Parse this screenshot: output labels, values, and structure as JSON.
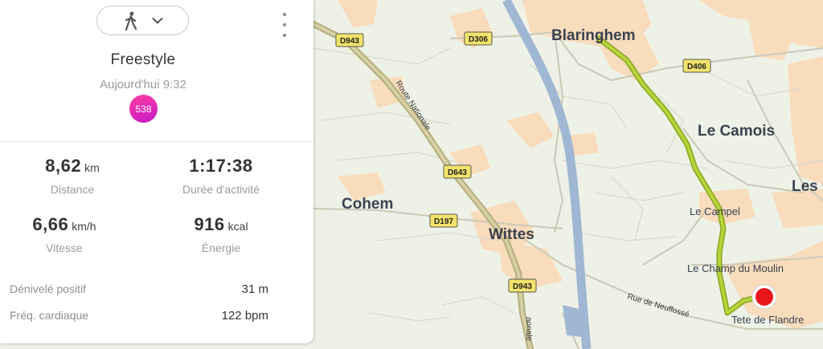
{
  "activity": {
    "type_icon": "walking-person-icon",
    "title": "Freestyle",
    "date": "Aujourd'hui 9:32",
    "badge": "538"
  },
  "stats": [
    {
      "value": "8,62",
      "unit": "km",
      "label": "Distance"
    },
    {
      "value": "1:17:38",
      "unit": "",
      "label": "Durée d'activité"
    },
    {
      "value": "6,66",
      "unit": "km/h",
      "label": "Vitesse"
    },
    {
      "value": "916",
      "unit": "kcal",
      "label": "Énergie"
    }
  ],
  "details": [
    {
      "label": "Dénivelé positif",
      "value": "31 m"
    },
    {
      "label": "Fréq. cardiaque",
      "value": "122 bpm"
    }
  ],
  "map": {
    "places": {
      "blaringhem": "Blaringhem",
      "le_camois": "Le Camois",
      "les_c": "Les C",
      "cohem": "Cohem",
      "wittes": "Wittes",
      "le_campel": "Le Campel",
      "le_champ_du_moulin": "Le Champ du Moulin",
      "tete_de_flandre": "Tete de Flandre"
    },
    "roads": {
      "d943_a": "D943",
      "d943_b": "D943",
      "d306": "D306",
      "d406": "D406",
      "d643": "D643",
      "d197": "D197",
      "route_nationale": "Route Nationale",
      "rue_de_neuffosse": "Rue de Neuffossé",
      "route_nationale_bottom": "aonale"
    },
    "colors": {
      "land": "#eef2e6",
      "urban": "#f6d9b8",
      "road": "#cfcbb8",
      "main_road": "#b5ae7d",
      "canal": "#9fb7d2",
      "track": "#b4cc3a",
      "end_marker": "#e8161b"
    }
  }
}
